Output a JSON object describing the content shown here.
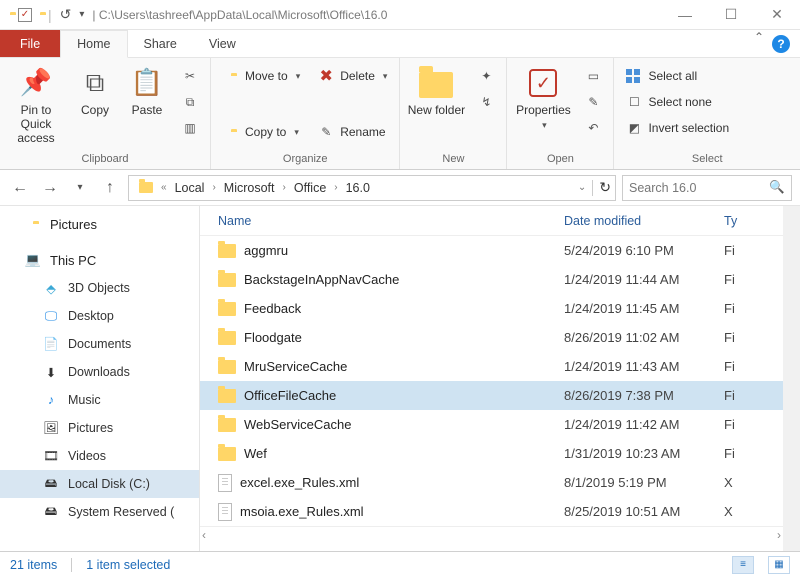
{
  "titlebar": {
    "path": "| C:\\Users\\tashreef\\AppData\\Local\\Microsoft\\Office\\16.0"
  },
  "tabs": {
    "file": "File",
    "home": "Home",
    "share": "Share",
    "view": "View"
  },
  "ribbon": {
    "clipboard": {
      "pin": "Pin to Quick access",
      "copy": "Copy",
      "paste": "Paste",
      "label": "Clipboard"
    },
    "organize": {
      "move_to": "Move to",
      "copy_to": "Copy to",
      "delete": "Delete",
      "rename": "Rename",
      "label": "Organize"
    },
    "new": {
      "new_folder": "New folder",
      "label": "New"
    },
    "open": {
      "properties": "Properties",
      "label": "Open"
    },
    "select": {
      "select_all": "Select all",
      "select_none": "Select none",
      "invert": "Invert selection",
      "label": "Select"
    }
  },
  "breadcrumb": {
    "segs": [
      "Local",
      "Microsoft",
      "Office",
      "16.0"
    ]
  },
  "search": {
    "placeholder": "Search 16.0"
  },
  "sidebar": {
    "pictures": "Pictures",
    "this_pc": "This PC",
    "items": [
      "3D Objects",
      "Desktop",
      "Documents",
      "Downloads",
      "Music",
      "Pictures",
      "Videos",
      "Local Disk (C:)",
      "System Reserved ("
    ]
  },
  "columns": {
    "name": "Name",
    "date": "Date modified",
    "type": "Ty"
  },
  "rows": [
    {
      "icon": "folder",
      "name": "aggmru",
      "date": "5/24/2019 6:10 PM",
      "type": "Fi"
    },
    {
      "icon": "folder",
      "name": "BackstageInAppNavCache",
      "date": "1/24/2019 11:44 AM",
      "type": "Fi"
    },
    {
      "icon": "folder",
      "name": "Feedback",
      "date": "1/24/2019 11:45 AM",
      "type": "Fi"
    },
    {
      "icon": "folder",
      "name": "Floodgate",
      "date": "8/26/2019 11:02 AM",
      "type": "Fi"
    },
    {
      "icon": "folder",
      "name": "MruServiceCache",
      "date": "1/24/2019 11:43 AM",
      "type": "Fi"
    },
    {
      "icon": "folder",
      "name": "OfficeFileCache",
      "date": "8/26/2019 7:38 PM",
      "type": "Fi",
      "selected": true
    },
    {
      "icon": "folder",
      "name": "WebServiceCache",
      "date": "1/24/2019 11:42 AM",
      "type": "Fi"
    },
    {
      "icon": "folder",
      "name": "Wef",
      "date": "1/31/2019 10:23 AM",
      "type": "Fi"
    },
    {
      "icon": "file",
      "name": "excel.exe_Rules.xml",
      "date": "8/1/2019 5:19 PM",
      "type": "X"
    },
    {
      "icon": "file",
      "name": "msoia.exe_Rules.xml",
      "date": "8/25/2019 10:51 AM",
      "type": "X"
    }
  ],
  "status": {
    "count": "21 items",
    "selected": "1 item selected"
  }
}
